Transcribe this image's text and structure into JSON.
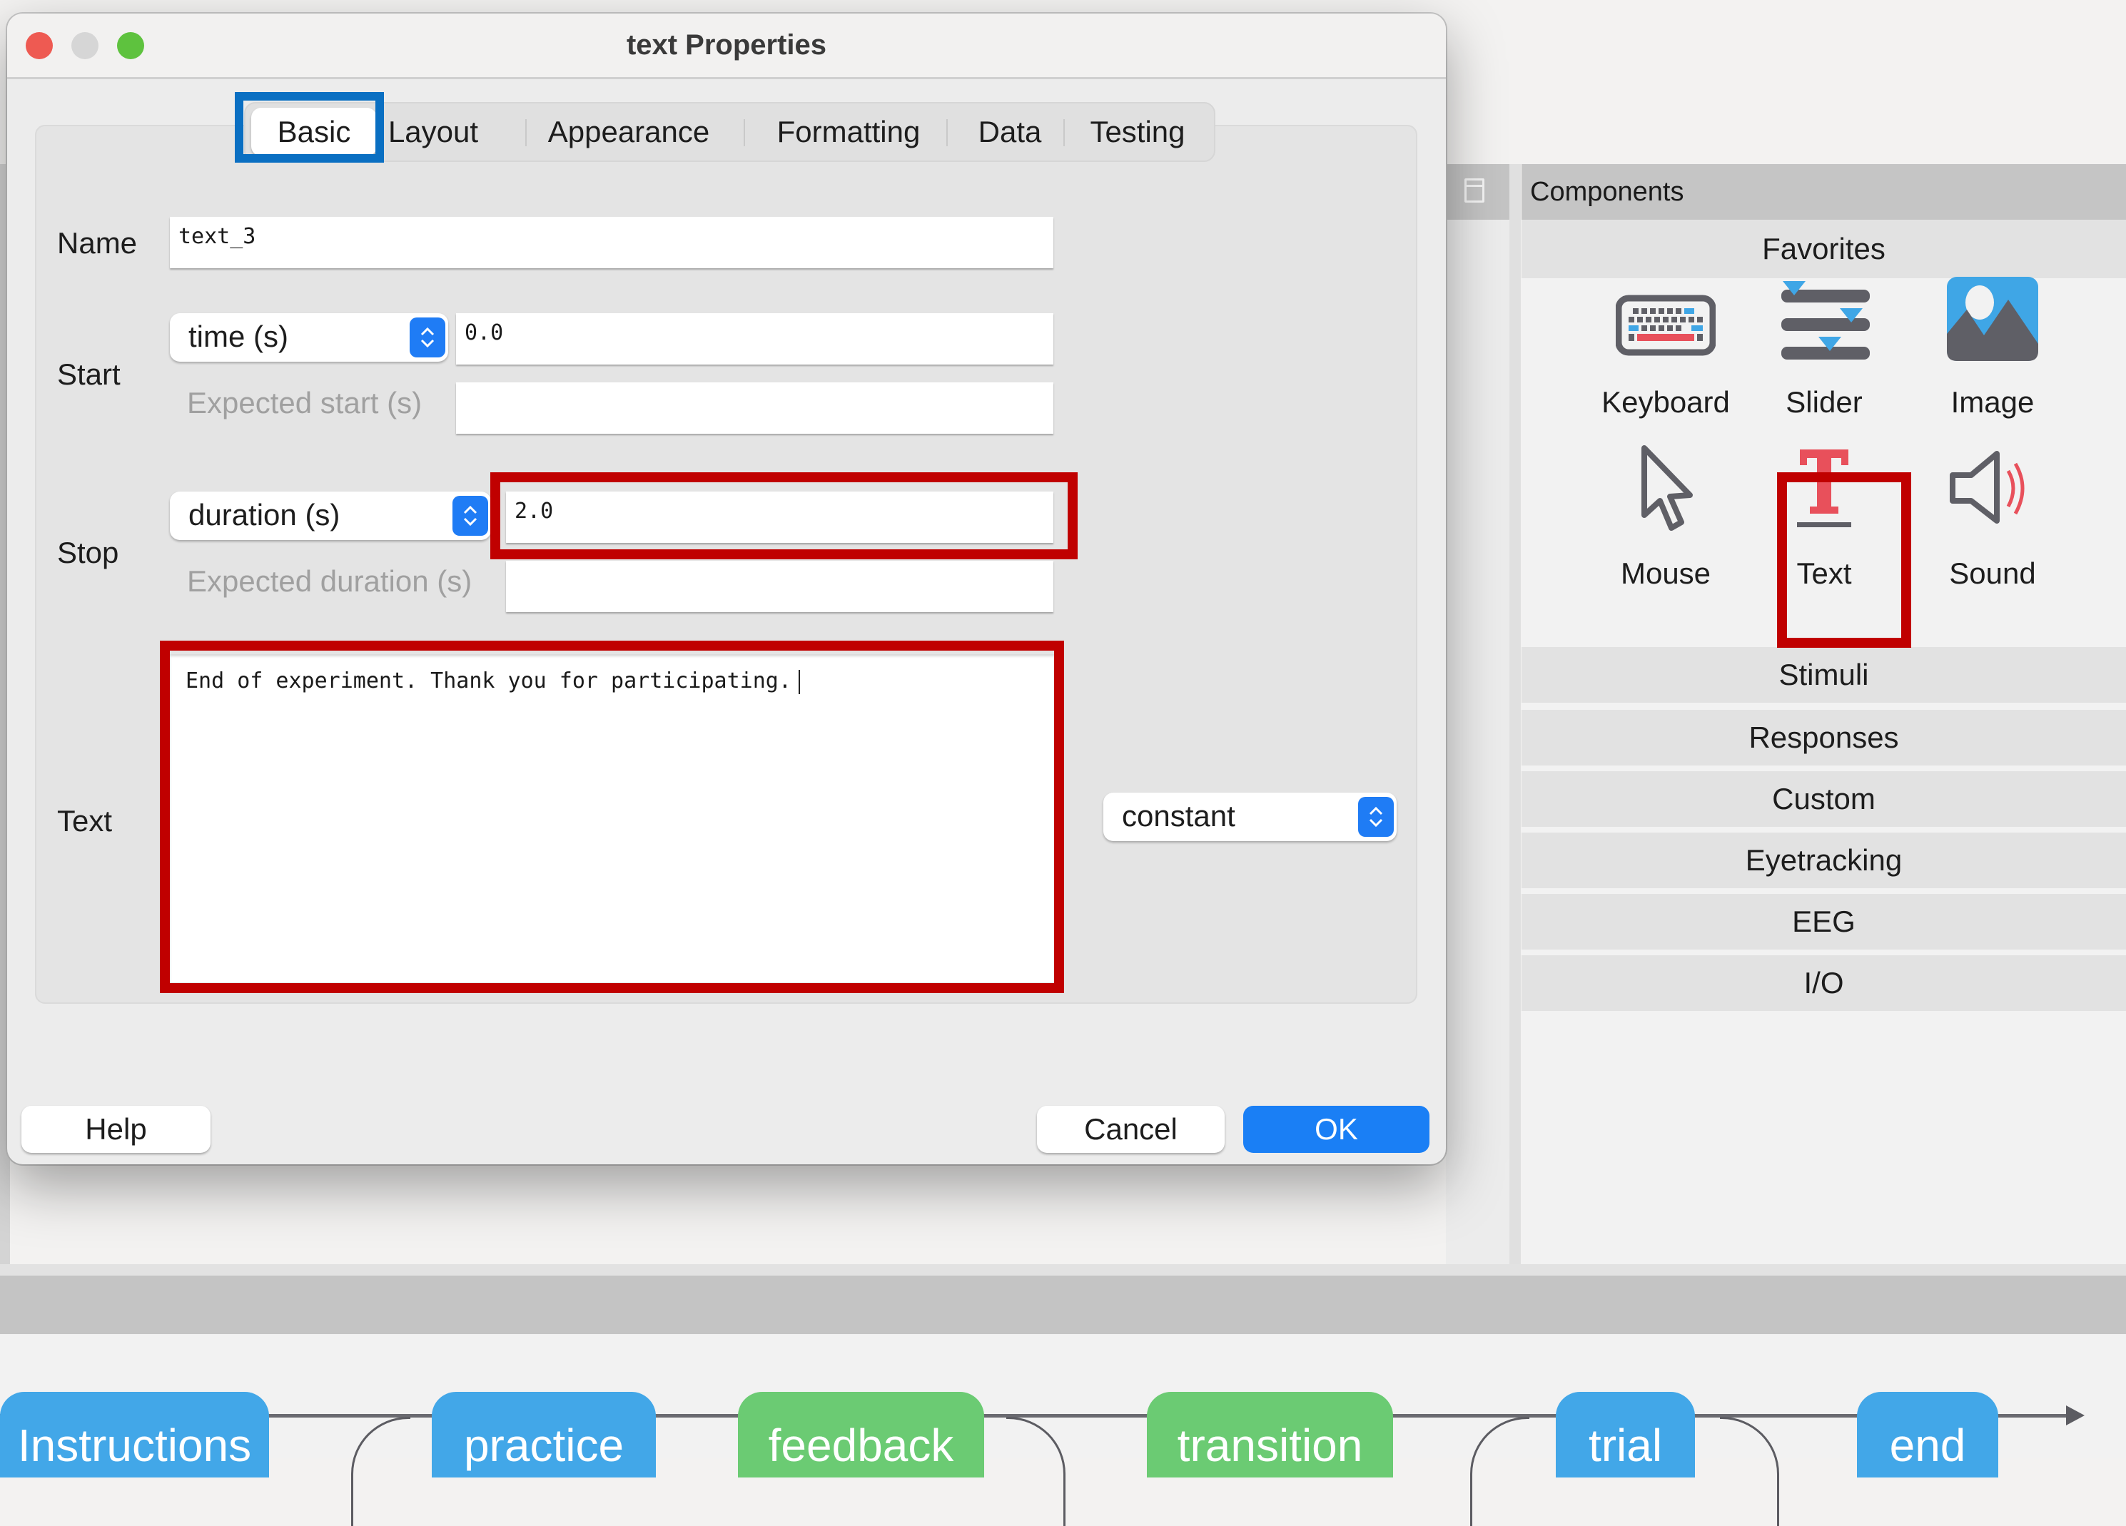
{
  "dialog": {
    "title": "text Properties",
    "tabs": [
      {
        "label": "Basic",
        "active": true
      },
      {
        "label": "Layout",
        "active": false
      },
      {
        "label": "Appearance",
        "active": false
      },
      {
        "label": "Formatting",
        "active": false
      },
      {
        "label": "Data",
        "active": false
      },
      {
        "label": "Testing",
        "active": false
      }
    ],
    "name": {
      "label": "Name",
      "value": "text_3"
    },
    "start": {
      "label": "Start",
      "type_selected": "time (s)",
      "value": "0.0",
      "expected_label": "Expected start (s)",
      "expected_value": ""
    },
    "stop": {
      "label": "Stop",
      "type_selected": "duration (s)",
      "value": "2.0",
      "expected_label": "Expected duration (s)",
      "expected_value": ""
    },
    "text": {
      "label": "Text",
      "value": "End of experiment. Thank you for participating.",
      "update_selected": "constant"
    },
    "buttons": {
      "help": "Help",
      "cancel": "Cancel",
      "ok": "OK"
    }
  },
  "components_panel": {
    "header": "Components",
    "favorites_label": "Favorites",
    "favorites": [
      {
        "label": "Keyboard",
        "icon": "keyboard-icon"
      },
      {
        "label": "Slider",
        "icon": "slider-icon"
      },
      {
        "label": "Image",
        "icon": "image-icon"
      },
      {
        "label": "Mouse",
        "icon": "mouse-cursor-icon"
      },
      {
        "label": "Text",
        "icon": "text-icon"
      },
      {
        "label": "Sound",
        "icon": "speaker-icon"
      }
    ],
    "categories": [
      "Stimuli",
      "Responses",
      "Custom",
      "Eyetracking",
      "EEG",
      "I/O"
    ]
  },
  "flow": {
    "routines": [
      {
        "label": "Instructions",
        "color": "#42a7e8"
      },
      {
        "label": "practice",
        "color": "#42a7e8"
      },
      {
        "label": "feedback",
        "color": "#6bcb73"
      },
      {
        "label": "transition",
        "color": "#6bcb73"
      },
      {
        "label": "trial",
        "color": "#42a7e8"
      },
      {
        "label": "end",
        "color": "#42a7e8"
      }
    ]
  },
  "colors": {
    "accent_blue": "#1a7ff5",
    "highlight_red": "#c00000",
    "highlight_blue": "#0a6fc2",
    "icon_red": "#e8505b",
    "icon_blue": "#3fa6e6",
    "icon_gray": "#5f5f66"
  }
}
